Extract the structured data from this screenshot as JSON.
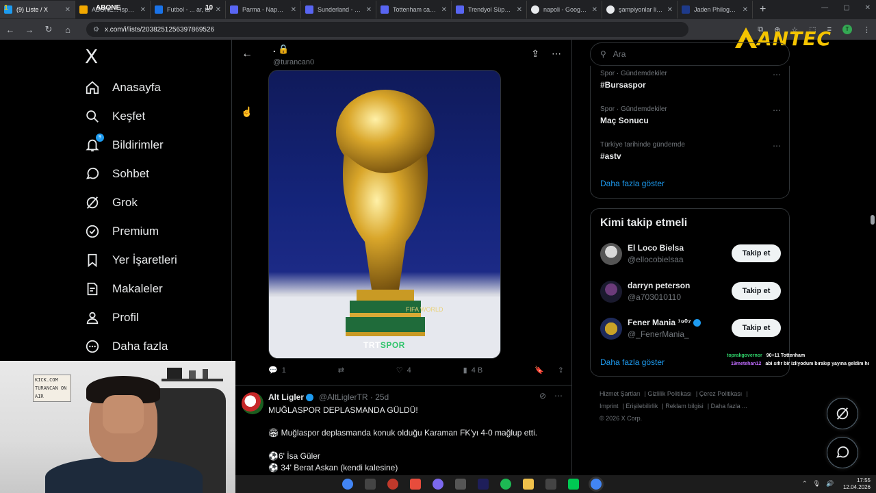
{
  "browser": {
    "tabs": [
      {
        "title": "(9) Liste / X",
        "color": "#1d9bf0"
      },
      {
        "title": "ABONE... lspor canlı",
        "color": "#f2a900"
      },
      {
        "title": "Futbol - ... ar, ta",
        "color": "#1a73e8"
      },
      {
        "title": "Parma - Napoli ca",
        "color": "#5865f2"
      },
      {
        "title": "Sunderland - Tott",
        "color": "#5865f2"
      },
      {
        "title": "Tottenham canlı s",
        "color": "#5865f2"
      },
      {
        "title": "Trendyol Süper Li",
        "color": "#5865f2"
      },
      {
        "title": "napoli - Google'd",
        "color": "#e8eaed"
      },
      {
        "title": "şampiyonlar ligi k",
        "color": "#e8eaed"
      },
      {
        "title": "Jaden Philogene",
        "color": "#1e3a8a"
      }
    ],
    "overlay_abone": "ABONE",
    "overlay_num1": "1",
    "overlay_num10": "10",
    "url": "x.com/i/lists/2038251256397869526",
    "new_tab": "+"
  },
  "logo": {
    "text": "ANTEC"
  },
  "sidebar": {
    "logo": "X",
    "items": [
      {
        "label": "Anasayfa",
        "icon": "home-icon"
      },
      {
        "label": "Keşfet",
        "icon": "search-icon"
      },
      {
        "label": "Bildirimler",
        "icon": "bell-icon",
        "badge": "9"
      },
      {
        "label": "Sohbet",
        "icon": "chat-icon"
      },
      {
        "label": "Grok",
        "icon": "grok-icon"
      },
      {
        "label": "Premium",
        "icon": "verified-icon"
      },
      {
        "label": "Yer İşaretleri",
        "icon": "bookmark-icon"
      },
      {
        "label": "Makaleler",
        "icon": "article-icon"
      },
      {
        "label": "Profil",
        "icon": "profile-icon"
      },
      {
        "label": "Daha fazla",
        "icon": "more-icon"
      }
    ]
  },
  "main": {
    "header_name": ".",
    "header_handle": "@turancan0",
    "media_watermark_a": "TRT",
    "media_watermark_b": "SPOR",
    "media_caption": "FIFA WORLD",
    "actions": {
      "replies": "1",
      "reposts": "",
      "likes": "4",
      "views": "4 B"
    },
    "tweet2": {
      "name": "Alt Ligler",
      "handle": "@AltLiglerTR · 25d",
      "lines": [
        "MUĞLASPOR DEPLASMANDA GÜLDÜ!",
        "🏟 Muğlaspor deplasmanda konuk olduğu Karaman FK'yı 4-0 mağlup etti.",
        "⚽6' İsa Güler",
        "⚽ 34' Berat Askan (kendi kalesine)"
      ]
    }
  },
  "right": {
    "search_placeholder": "Ara",
    "trends": [
      {
        "category": "Spor · Gündemdekiler",
        "tag": "#Bursaspor"
      },
      {
        "category": "Spor · Gündemdekiler",
        "tag": "Maç Sonucu"
      },
      {
        "category": "Türkiye tarihinde gündemde",
        "tag": "#astv"
      }
    ],
    "trends_more": "Daha fazla göster",
    "follow_title": "Kimi takip etmeli",
    "follow": [
      {
        "name": "El Loco Bielsa",
        "handle": "@ellocobielsaa",
        "button": "Takip et"
      },
      {
        "name": "darryn peterson",
        "handle": "@a703010110",
        "button": "Takip et"
      },
      {
        "name": "Fener Mania ¹⁹⁰⁷",
        "handle": "@_FenerMania_",
        "button": "Takip et"
      }
    ],
    "follow_more": "Daha fazla göster",
    "footer": {
      "links": [
        "Hizmet Şartları",
        "Gizlilik Politikası",
        "Çerez Politikası",
        "Imprint",
        "Erişilebilirlik",
        "Reklam bilgisi",
        "Daha fazla ..."
      ],
      "copyright": "© 2026 X Corp."
    }
  },
  "stream_chat": [
    {
      "user": "toprakgovernor",
      "message": "90+11 Tottenham",
      "color": "#2fd36a"
    },
    {
      "user": "19metehan12",
      "message": "abi sıfır bir izliyodum bırakıp yayına geldim he",
      "color": "#c06cff"
    }
  ],
  "webcam": {
    "sign": "KICK.COM TURANCAN ON AIR"
  },
  "taskbar": {
    "time": "17:55",
    "date": "12.04.2026"
  },
  "colors": {
    "accent": "#1d9bf0",
    "background": "#000000",
    "border": "#2f3336",
    "muted": "#71767b"
  }
}
